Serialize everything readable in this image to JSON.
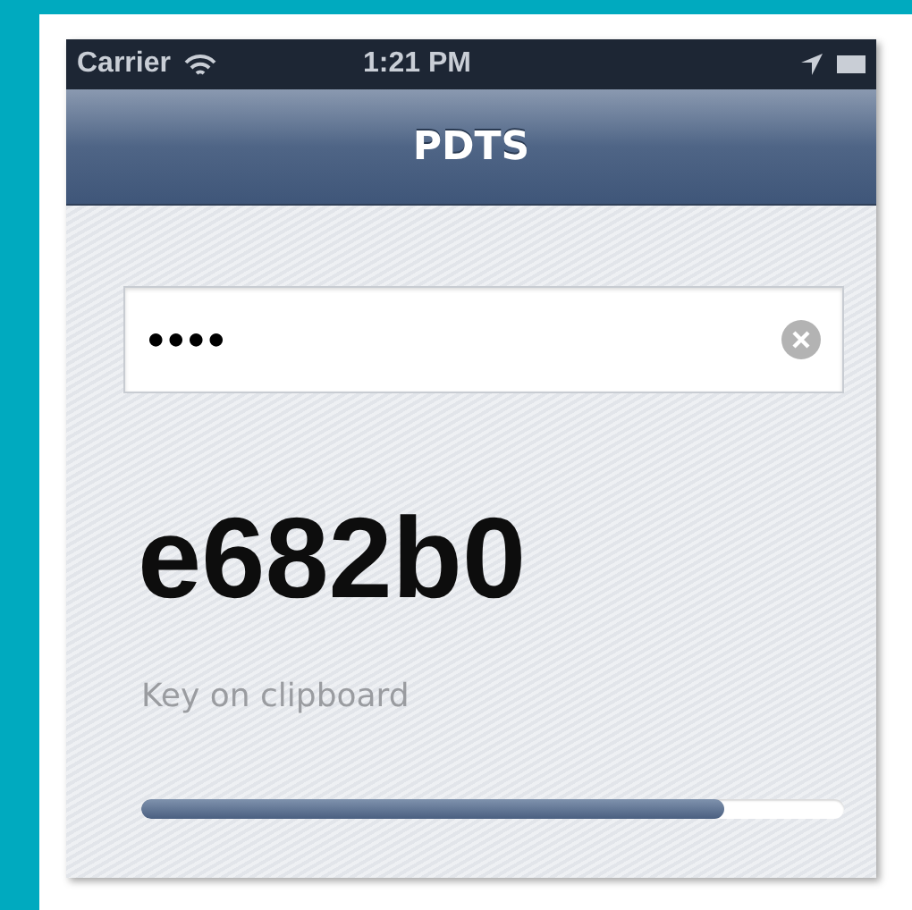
{
  "status_bar": {
    "carrier": "Carrier",
    "time": "1:21 PM"
  },
  "nav_bar": {
    "title": "PDTS"
  },
  "passcode_field": {
    "value": "●●●●"
  },
  "key": {
    "value": "e682b0",
    "caption": "Key on clipboard"
  },
  "progress": {
    "level": 0.83
  }
}
